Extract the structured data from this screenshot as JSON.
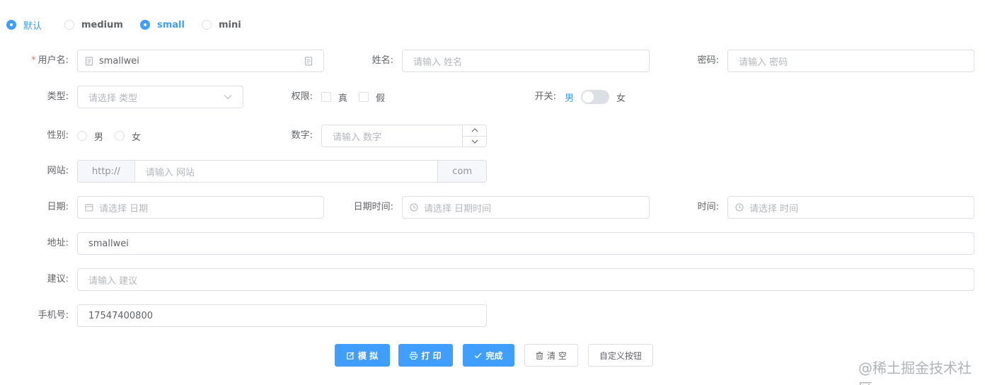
{
  "size_radios": [
    {
      "label": "默认",
      "checked": true
    },
    {
      "label": "medium",
      "checked": false
    },
    {
      "label": "small",
      "checked": true
    },
    {
      "label": "mini",
      "checked": false
    }
  ],
  "form": {
    "username": {
      "label": "用户名:",
      "required_mark": "*",
      "value": "smallwei"
    },
    "name": {
      "label": "姓名:",
      "placeholder": "请输入 姓名"
    },
    "password": {
      "label": "密码:",
      "placeholder": "请输入 密码"
    },
    "type": {
      "label": "类型:",
      "placeholder": "请选择 类型"
    },
    "permission": {
      "label": "权限:",
      "options": [
        "真",
        "假"
      ]
    },
    "switch": {
      "label": "开关:",
      "active_text": "男",
      "inactive_text": "女"
    },
    "gender": {
      "label": "性别:",
      "options": [
        "男",
        "女"
      ]
    },
    "number": {
      "label": "数字:",
      "placeholder": "请输入 数字"
    },
    "website": {
      "label": "网站:",
      "prefix": "http://",
      "placeholder": "请输入 网站",
      "suffix": "com"
    },
    "date": {
      "label": "日期:",
      "placeholder": "请选择 日期"
    },
    "datetime": {
      "label": "日期时间:",
      "placeholder": "请选择 日期时间"
    },
    "time": {
      "label": "时间:",
      "placeholder": "请选择 时间"
    },
    "address": {
      "label": "地址:",
      "value": "smallwei"
    },
    "suggestion": {
      "label": "建议:",
      "placeholder": "请输入 建议"
    },
    "phone": {
      "label": "手机号:",
      "value": "17547400800"
    }
  },
  "buttons": {
    "simulate": "模 拟",
    "print": "打 印",
    "done": "完成",
    "clear": "清 空",
    "custom": "自定义按钮"
  },
  "watermark": "@稀土掘金技术社区",
  "colors": {
    "primary": "#409eff",
    "required": "#f56c6c",
    "border": "#dcdfe6"
  }
}
